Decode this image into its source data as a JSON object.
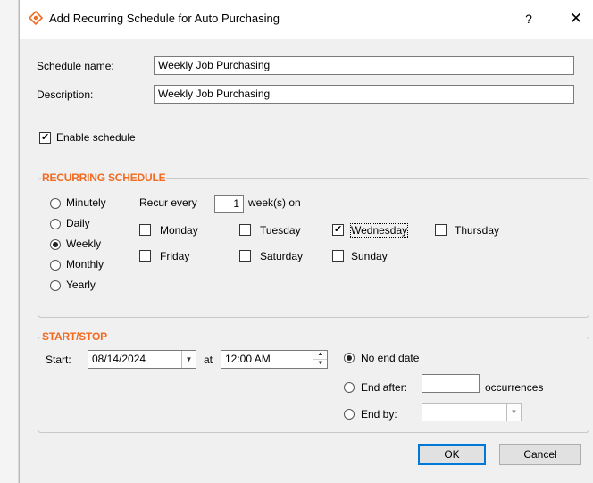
{
  "window": {
    "title": "Add Recurring Schedule for Auto Purchasing",
    "help_label": "?",
    "close_label": "✕"
  },
  "form": {
    "schedule_name_label": "Schedule name:",
    "schedule_name_value": "Weekly Job Purchasing",
    "description_label": "Description:",
    "description_value": "Weekly Job Purchasing",
    "enable_label": "Enable schedule",
    "enable_checked": true
  },
  "recurring": {
    "title": "RECURRING SCHEDULE",
    "frequencies": [
      {
        "label": "Minutely",
        "selected": false
      },
      {
        "label": "Daily",
        "selected": false
      },
      {
        "label": "Weekly",
        "selected": true
      },
      {
        "label": "Monthly",
        "selected": false
      },
      {
        "label": "Yearly",
        "selected": false
      }
    ],
    "recur_every_label": "Recur every",
    "recur_every_value": "1",
    "weeks_on_label": "week(s) on",
    "days": [
      {
        "label": "Monday",
        "checked": false
      },
      {
        "label": "Tuesday",
        "checked": false
      },
      {
        "label": "Wednesday",
        "checked": true
      },
      {
        "label": "Thursday",
        "checked": false
      },
      {
        "label": "Friday",
        "checked": false
      },
      {
        "label": "Saturday",
        "checked": false
      },
      {
        "label": "Sunday",
        "checked": false
      }
    ]
  },
  "startstop": {
    "title": "START/STOP",
    "start_label": "Start:",
    "start_date": "08/14/2024",
    "at_label": "at",
    "start_time": "12:00 AM",
    "no_end_label": "No end date",
    "end_after_label": "End after:",
    "end_after_value": "",
    "occurrences_label": "occurrences",
    "end_by_label": "End by:",
    "end_by_value": "",
    "end_option": "no_end"
  },
  "buttons": {
    "ok_label": "OK",
    "cancel_label": "Cancel"
  },
  "colors": {
    "accent": "#f26b21",
    "default_button_border": "#0078d7"
  }
}
